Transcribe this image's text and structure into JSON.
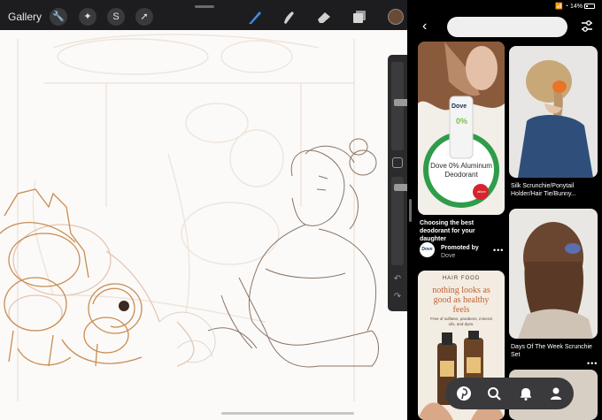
{
  "procreate": {
    "gallery_label": "Gallery",
    "tools_left": [
      {
        "name": "actions-wrench-icon",
        "glyph": "🔧"
      },
      {
        "name": "adjustments-wand-icon",
        "glyph": "✦"
      },
      {
        "name": "selection-icon",
        "glyph": "S"
      },
      {
        "name": "transform-arrow-icon",
        "glyph": "➚"
      }
    ],
    "tools_right": [
      {
        "name": "brush-icon"
      },
      {
        "name": "smudge-icon"
      },
      {
        "name": "eraser-icon"
      },
      {
        "name": "layers-icon"
      }
    ],
    "current_color": "#6a4a32",
    "sidebar": {
      "undo_glyph": "↶",
      "redo_glyph": "↷"
    }
  },
  "pinterest": {
    "status": {
      "icons": "📶 ◔",
      "battery": "14%"
    },
    "back_glyph": "‹",
    "search_placeholder": "",
    "pins": [
      {
        "id": "dove",
        "ad_title": "Dove 0% Aluminum Deodorant",
        "stamp": "allure",
        "title": "Choosing the best deodorant for your daughter",
        "promoted_label": "Promoted by",
        "brand": "Dove",
        "logo_text": "Dove",
        "product_name": "Dove",
        "product_sub": "0%"
      },
      {
        "id": "scrunchie-ponytail",
        "title": "Silk Scrunchie/Ponytail Holder/Hair Tie/Bunny..."
      },
      {
        "id": "hairfood",
        "brand_text": "HAIR FOOD",
        "headline": "nothing looks as good as healthy feels",
        "sub": "Free of sulfates, parabens, mineral oils, and dyes."
      },
      {
        "id": "days-of-week",
        "title": "Days Of The Week Scrunchie Set"
      }
    ],
    "more_glyph": "•••",
    "nav": [
      "home-icon",
      "search-icon",
      "notifications-bell-icon",
      "profile-icon"
    ]
  }
}
